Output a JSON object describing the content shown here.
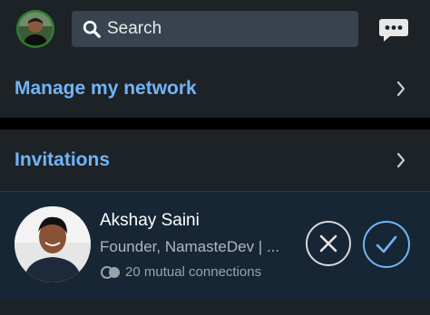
{
  "search": {
    "label": "Search"
  },
  "rows": {
    "manage": "Manage my network",
    "invitations": "Invitations"
  },
  "invite": {
    "name": "Akshay Saini",
    "headline": "Founder, NamasteDev | ...",
    "mutual": "20 mutual connections"
  },
  "icons": {
    "search": "search-icon",
    "messaging": "messaging-icon",
    "chevron": "chevron-right-icon",
    "ignore": "close-icon",
    "accept": "check-icon",
    "mutual": "mutual-connections-icon"
  },
  "colors": {
    "accent": "#70b5f9",
    "surface": "#1d2226",
    "card": "#172634"
  }
}
